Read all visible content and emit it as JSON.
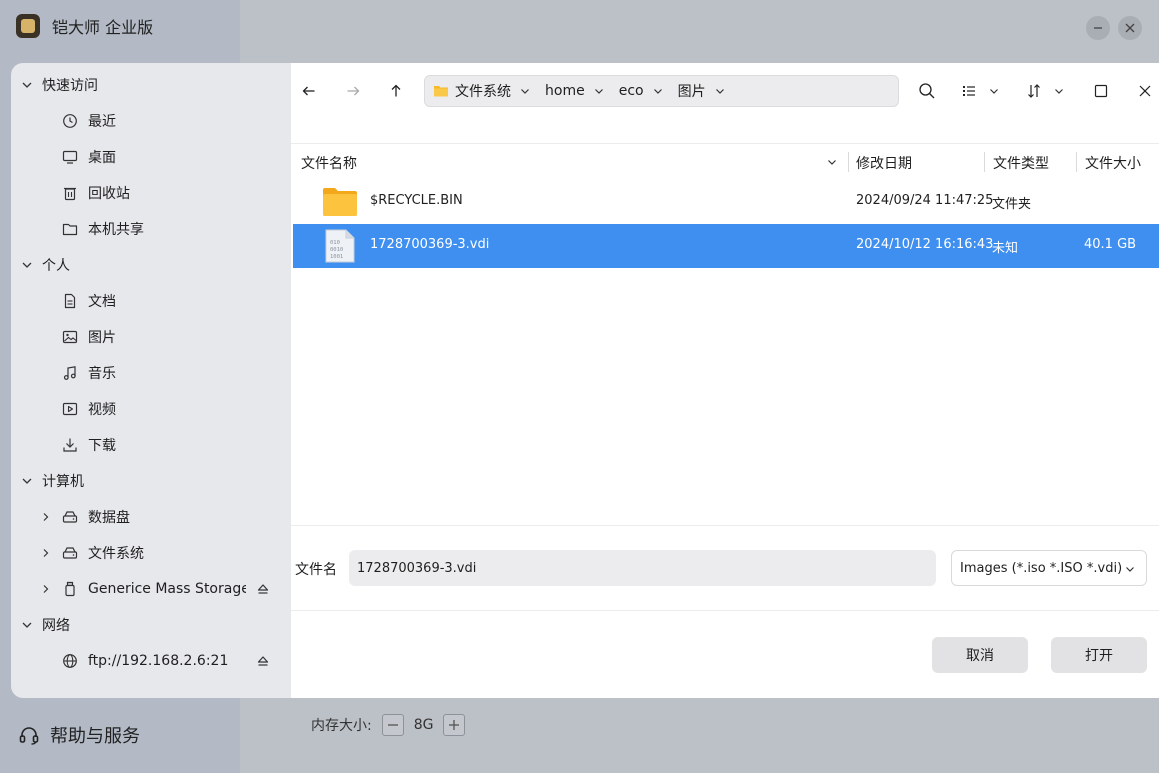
{
  "background_app": {
    "title": "铠大师 企业版",
    "help_label": "帮助与服务",
    "memory_label": "内存大小:",
    "memory_value": "8G"
  },
  "sidebar": {
    "groups": [
      {
        "label": "快速访问",
        "items": [
          {
            "label": "最近",
            "icon": "clock-icon"
          },
          {
            "label": "桌面",
            "icon": "desktop-icon"
          },
          {
            "label": "回收站",
            "icon": "trash-icon"
          },
          {
            "label": "本机共享",
            "icon": "folder-icon"
          }
        ]
      },
      {
        "label": "个人",
        "items": [
          {
            "label": "文档",
            "icon": "document-icon"
          },
          {
            "label": "图片",
            "icon": "image-icon"
          },
          {
            "label": "音乐",
            "icon": "music-icon"
          },
          {
            "label": "视频",
            "icon": "video-icon"
          },
          {
            "label": "下载",
            "icon": "download-icon"
          }
        ]
      },
      {
        "label": "计算机",
        "items": [
          {
            "label": "数据盘",
            "icon": "drive-icon"
          },
          {
            "label": "文件系统",
            "icon": "drive-icon"
          },
          {
            "label": "Generice Mass Storage …",
            "icon": "usb-icon"
          }
        ]
      },
      {
        "label": "网络",
        "items": [
          {
            "label": "ftp://192.168.2.6:21",
            "icon": "network-icon"
          }
        ]
      }
    ]
  },
  "toolbar": {
    "breadcrumb": [
      "文件系统",
      "home",
      "eco",
      "图片"
    ]
  },
  "file_list": {
    "columns": [
      "文件名称",
      "修改日期",
      "文件类型",
      "文件大小"
    ],
    "rows": [
      {
        "name": "$RECYCLE.BIN",
        "modified": "2024/09/24 11:47:25",
        "type": "文件夹",
        "size": "",
        "icon": "folder-icon",
        "selected": false
      },
      {
        "name": "1728700369-3.vdi",
        "modified": "2024/10/12 16:16:43",
        "type": "未知",
        "size": "40.1 GB",
        "icon": "binary-file-icon",
        "selected": true
      }
    ]
  },
  "footer": {
    "filename_label": "文件名",
    "filename_value": "1728700369-3.vdi",
    "filter_value": "Images (*.iso *.ISO *.vdi)",
    "cancel_label": "取消",
    "open_label": "打开"
  },
  "colors": {
    "selection": "#3e8ff0",
    "sidebar_bg": "#e7e8ec",
    "folder": "#f7b92a"
  }
}
